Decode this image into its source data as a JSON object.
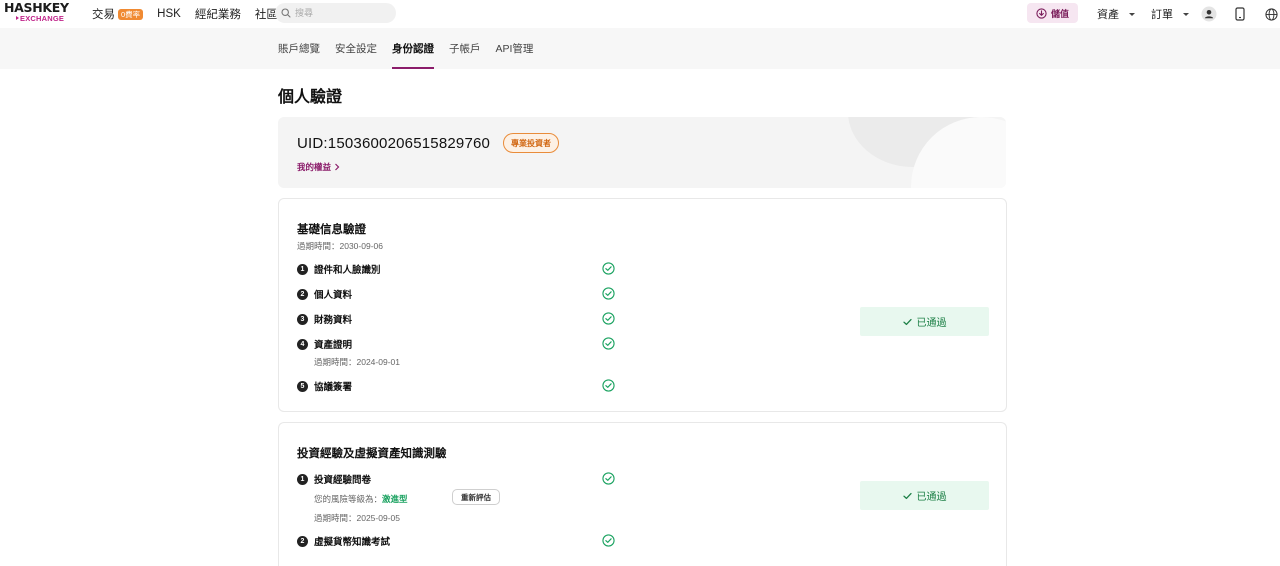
{
  "brand": {
    "logo_top": "HASHKEY",
    "logo_bottom": "EXCHANGE"
  },
  "nav": {
    "items": [
      {
        "label": "交易",
        "badge": "0費率"
      },
      {
        "label": "HSK"
      },
      {
        "label": "經紀業務"
      },
      {
        "label": "社區"
      }
    ],
    "search_placeholder": "搜尋",
    "deposit_label": "儲值",
    "assets_label": "資產",
    "orders_label": "訂單",
    "icons": [
      "user-icon",
      "phone-icon",
      "globe-icon"
    ]
  },
  "tabs": [
    {
      "label": "賬戶總覽",
      "active": false
    },
    {
      "label": "安全設定",
      "active": false
    },
    {
      "label": "身份認證",
      "active": true
    },
    {
      "label": "子帳戶",
      "active": false
    },
    {
      "label": "API管理",
      "active": false
    }
  ],
  "page_title": "個人驗證",
  "uid_card": {
    "uid": "UID:1503600206515829760",
    "badge": "專業投資者",
    "rights_link": "我的權益"
  },
  "basic": {
    "title": "基礎信息驗證",
    "expiry": "過期時間：2030-09-06",
    "steps": [
      {
        "num": "1",
        "label": "證件和人臉識別"
      },
      {
        "num": "2",
        "label": "個人資料"
      },
      {
        "num": "3",
        "label": "財務資料"
      },
      {
        "num": "4",
        "label": "資產證明",
        "note": "過期時間：2024-09-01"
      },
      {
        "num": "5",
        "label": "協議簽署"
      }
    ],
    "status": "已通過"
  },
  "knowledge": {
    "title": "投資經驗及虛擬資產知識測驗",
    "steps": [
      {
        "num": "1",
        "label": "投資經驗問卷"
      },
      {
        "num": "2",
        "label": "虛擬貨幣知識考試"
      }
    ],
    "risk_prefix": "您的風險等級為：",
    "risk_level": "激進型",
    "reassess_label": "重新評估",
    "expiry": "過期時間：2025-09-05",
    "status": "已通過"
  },
  "colors": {
    "brand": "#8b1c6a",
    "success": "#1aa260",
    "success_bg": "#e8f8ef",
    "badge_orange": "#f08a32"
  }
}
